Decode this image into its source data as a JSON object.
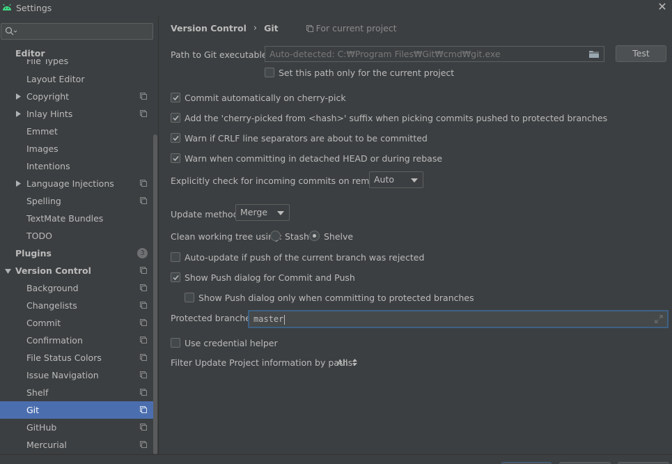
{
  "window": {
    "title": "Settings"
  },
  "sidebar": {
    "search_placeholder": "",
    "items": [
      {
        "label": "Editor",
        "level": 0,
        "bold": true
      },
      {
        "label": "File Types",
        "level": 1
      },
      {
        "label": "Layout Editor",
        "level": 1
      },
      {
        "label": "Copyright",
        "level": 1,
        "expandable": true,
        "project_icon": true
      },
      {
        "label": "Inlay Hints",
        "level": 1,
        "expandable": true,
        "project_icon": true
      },
      {
        "label": "Emmet",
        "level": 1
      },
      {
        "label": "Images",
        "level": 1
      },
      {
        "label": "Intentions",
        "level": 1
      },
      {
        "label": "Language Injections",
        "level": 1,
        "expandable": true,
        "project_icon": true
      },
      {
        "label": "Spelling",
        "level": 1,
        "project_icon": true
      },
      {
        "label": "TextMate Bundles",
        "level": 1
      },
      {
        "label": "TODO",
        "level": 1
      },
      {
        "label": "Plugins",
        "level": 0,
        "bold": true,
        "badge": "3"
      },
      {
        "label": "Version Control",
        "level": 0,
        "bold": true,
        "expanded": true,
        "project_icon": true
      },
      {
        "label": "Background",
        "level": 1,
        "project_icon": true
      },
      {
        "label": "Changelists",
        "level": 1,
        "project_icon": true
      },
      {
        "label": "Commit",
        "level": 1,
        "project_icon": true
      },
      {
        "label": "Confirmation",
        "level": 1,
        "project_icon": true
      },
      {
        "label": "File Status Colors",
        "level": 1,
        "project_icon": true
      },
      {
        "label": "Issue Navigation",
        "level": 1,
        "project_icon": true
      },
      {
        "label": "Shelf",
        "level": 1,
        "project_icon": true
      },
      {
        "label": "Git",
        "level": 1,
        "project_icon": true,
        "selected": true
      },
      {
        "label": "GitHub",
        "level": 1,
        "project_icon": true
      },
      {
        "label": "Mercurial",
        "level": 1,
        "project_icon": true
      }
    ]
  },
  "content": {
    "breadcrumb": [
      "Version Control",
      "Git"
    ],
    "breadcrumb_separator": "›",
    "scope_label": "For current project",
    "git_path": {
      "label": "Path to Git executable:",
      "placeholder": "Auto-detected: C:₩Program Files₩Git₩cmd₩git.exe",
      "test_button": "Test",
      "current_project_only": {
        "label": "Set this path only for the current project",
        "checked": false
      }
    },
    "options": {
      "commit_cherry_pick": {
        "label": "Commit automatically on cherry-pick",
        "checked": true
      },
      "cherry_picked_suffix": {
        "label": "Add the 'cherry-picked from <hash>' suffix when picking commits pushed to protected branches",
        "checked": true
      },
      "warn_crlf": {
        "label": "Warn if CRLF line separators are about to be committed",
        "checked": true
      },
      "warn_detached": {
        "label": "Warn when committing in detached HEAD or during rebase",
        "checked": true
      }
    },
    "incoming_commits": {
      "label": "Explicitly check for incoming commits on remotes:",
      "value": "Auto"
    },
    "update_method": {
      "label": "Update method:",
      "value": "Merge"
    },
    "clean_tree": {
      "label": "Clean working tree using:",
      "options": [
        {
          "label": "Stash",
          "selected": false
        },
        {
          "label": "Shelve",
          "selected": true
        }
      ]
    },
    "auto_update": {
      "label": "Auto-update if push of the current branch was rejected",
      "checked": false
    },
    "show_push_dialog": {
      "label": "Show Push dialog for Commit and Push",
      "checked": true
    },
    "show_push_protected": {
      "label": "Show Push dialog only when committing to protected branches",
      "checked": false
    },
    "protected_branches": {
      "label": "Protected branches:",
      "value": "master"
    },
    "credential_helper": {
      "label": "Use credential helper",
      "checked": false
    },
    "filter_update": {
      "label": "Filter Update Project information by paths:",
      "value": "All"
    }
  },
  "colors": {
    "background": "#3c3f41",
    "selection": "#4b6eaf",
    "text": "#bbbbbb",
    "focus_border": "#3d6185"
  }
}
